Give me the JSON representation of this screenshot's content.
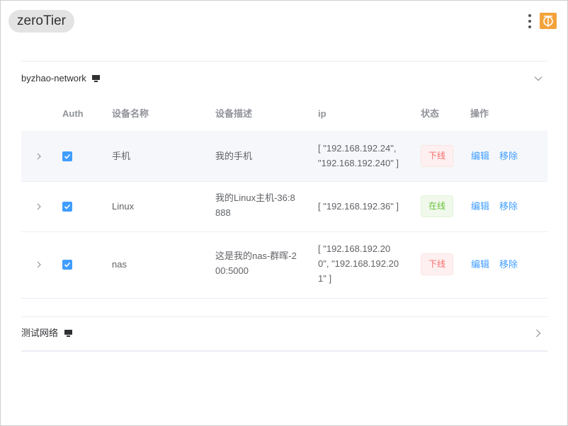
{
  "app": {
    "title": "zeroTier",
    "more_icon": "more-vertical-icon",
    "logo_icon": "zerotier-logo-icon"
  },
  "networks": [
    {
      "name": "byzhao-network",
      "icon": "monitor-icon",
      "expanded": true,
      "arrow_icon": "chevron-down-icon"
    },
    {
      "name": "测试网络",
      "icon": "monitor-icon",
      "expanded": false,
      "arrow_icon": "chevron-right-icon"
    }
  ],
  "table": {
    "headers": {
      "auth": "Auth",
      "name": "设备名称",
      "desc": "设备描述",
      "ip": "ip",
      "status": "状态",
      "actions": "操作"
    },
    "rows": [
      {
        "checked": true,
        "name": "手机",
        "desc1": "我的手机",
        "desc2": "",
        "ip1": "[ \"192.168.192.24\",",
        "ip2": "\"192.168.192.240\" ]",
        "ip3": "",
        "status": "下线",
        "status_type": "offline",
        "edit": "编辑",
        "remove": "移除"
      },
      {
        "checked": true,
        "name": "Linux",
        "desc1": "我的Linux主机-36:8",
        "desc2": "888",
        "ip1": "[ \"192.168.192.36\" ]",
        "ip2": "",
        "ip3": "",
        "status": "在线",
        "status_type": "online",
        "edit": "编辑",
        "remove": "移除"
      },
      {
        "checked": true,
        "name": "nas",
        "desc1": "这是我的nas-群晖-2",
        "desc2": "00:5000",
        "ip1": "[ \"192.168.192.20",
        "ip2": "0\", \"192.168.192.20",
        "ip3": "1\" ]",
        "status": "下线",
        "status_type": "offline",
        "edit": "编辑",
        "remove": "移除"
      }
    ]
  },
  "colors": {
    "primary": "#409eff",
    "danger": "#f56c6c",
    "success": "#67c23a",
    "logo": "#f3a33c"
  }
}
